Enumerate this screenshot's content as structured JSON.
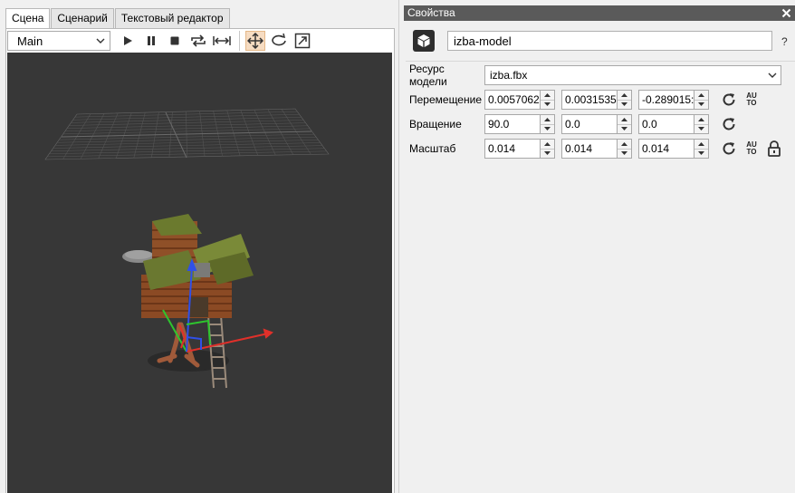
{
  "tabs": [
    {
      "label": "Сцена",
      "active": true
    },
    {
      "label": "Сценарий",
      "active": false
    },
    {
      "label": "Текстовый редактор",
      "active": false
    }
  ],
  "toolbar": {
    "camera_select": "Main",
    "buttons": [
      "play-icon",
      "pause-icon",
      "stop-icon",
      "loop-icon",
      "fit-width-icon",
      "move-icon",
      "rotate-icon",
      "scale-icon"
    ],
    "active_tool": "move-icon"
  },
  "properties": {
    "title": "Свойства",
    "object_name": "izba-model",
    "help": "?",
    "resource": {
      "label": "Ресурс модели",
      "value": "izba.fbx"
    },
    "position": {
      "label": "Перемещение",
      "x": "0.0057062",
      "y": "0.0031535",
      "z": "-0.289015:"
    },
    "rotation": {
      "label": "Вращение",
      "x": "90.0",
      "y": "0.0",
      "z": "0.0"
    },
    "scale": {
      "label": "Масштаб",
      "x": "0.014",
      "y": "0.014",
      "z": "0.014"
    },
    "auto_label": "AU TO"
  },
  "colors": {
    "viewport_bg": "#373737",
    "titlebar_bg": "#5a5a5a",
    "active_tool_bg": "#f6dcc2",
    "gizmo_x": "#e0302a",
    "gizmo_y": "#2ec52e",
    "gizmo_z": "#3050e8"
  }
}
